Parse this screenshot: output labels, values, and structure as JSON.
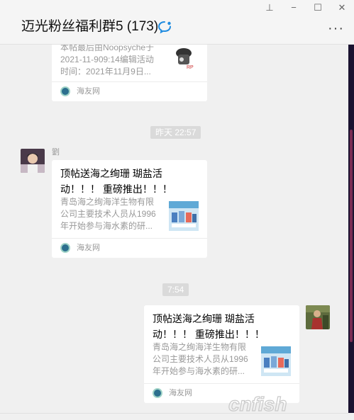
{
  "window": {
    "pin_label": "⊥",
    "minimize_label": "−",
    "maximize_label": "☐",
    "close_label": "✕"
  },
  "header": {
    "title": "迈光粉丝福利群5 (173)",
    "more_label": "···"
  },
  "messages": [
    {
      "type": "card",
      "desc_lines": [
        "本帖最后由Noopsyche于",
        "2021-11-909:14编辑活动",
        "时间：2021年11月9日..."
      ],
      "source": "海友网"
    },
    {
      "type": "time",
      "text": "昨天 22:57"
    },
    {
      "type": "card",
      "sender": "劉",
      "title": "顶帖送海之绚珊 瑚盐活动！！！ 重磅推出！！！",
      "desc_lines": [
        "青岛海之绚海洋生物有限",
        "公司主要技术人员从1996",
        "年开始参与海水素的研..."
      ],
      "source": "海友网"
    },
    {
      "type": "time",
      "text": "7:54"
    },
    {
      "type": "card",
      "title": "顶帖送海之绚珊 瑚盐活动！！！ 重磅推出！！！",
      "desc_lines": [
        "青岛海之绚海洋生物有限",
        "公司主要技术人员从1996",
        "年开始参与海水素的研..."
      ],
      "source": "海友网"
    }
  ],
  "watermark": "cnfish",
  "colors": {
    "accent": "#1f8be0",
    "bubble": "#ffffff",
    "background": "#f0f0f0"
  }
}
